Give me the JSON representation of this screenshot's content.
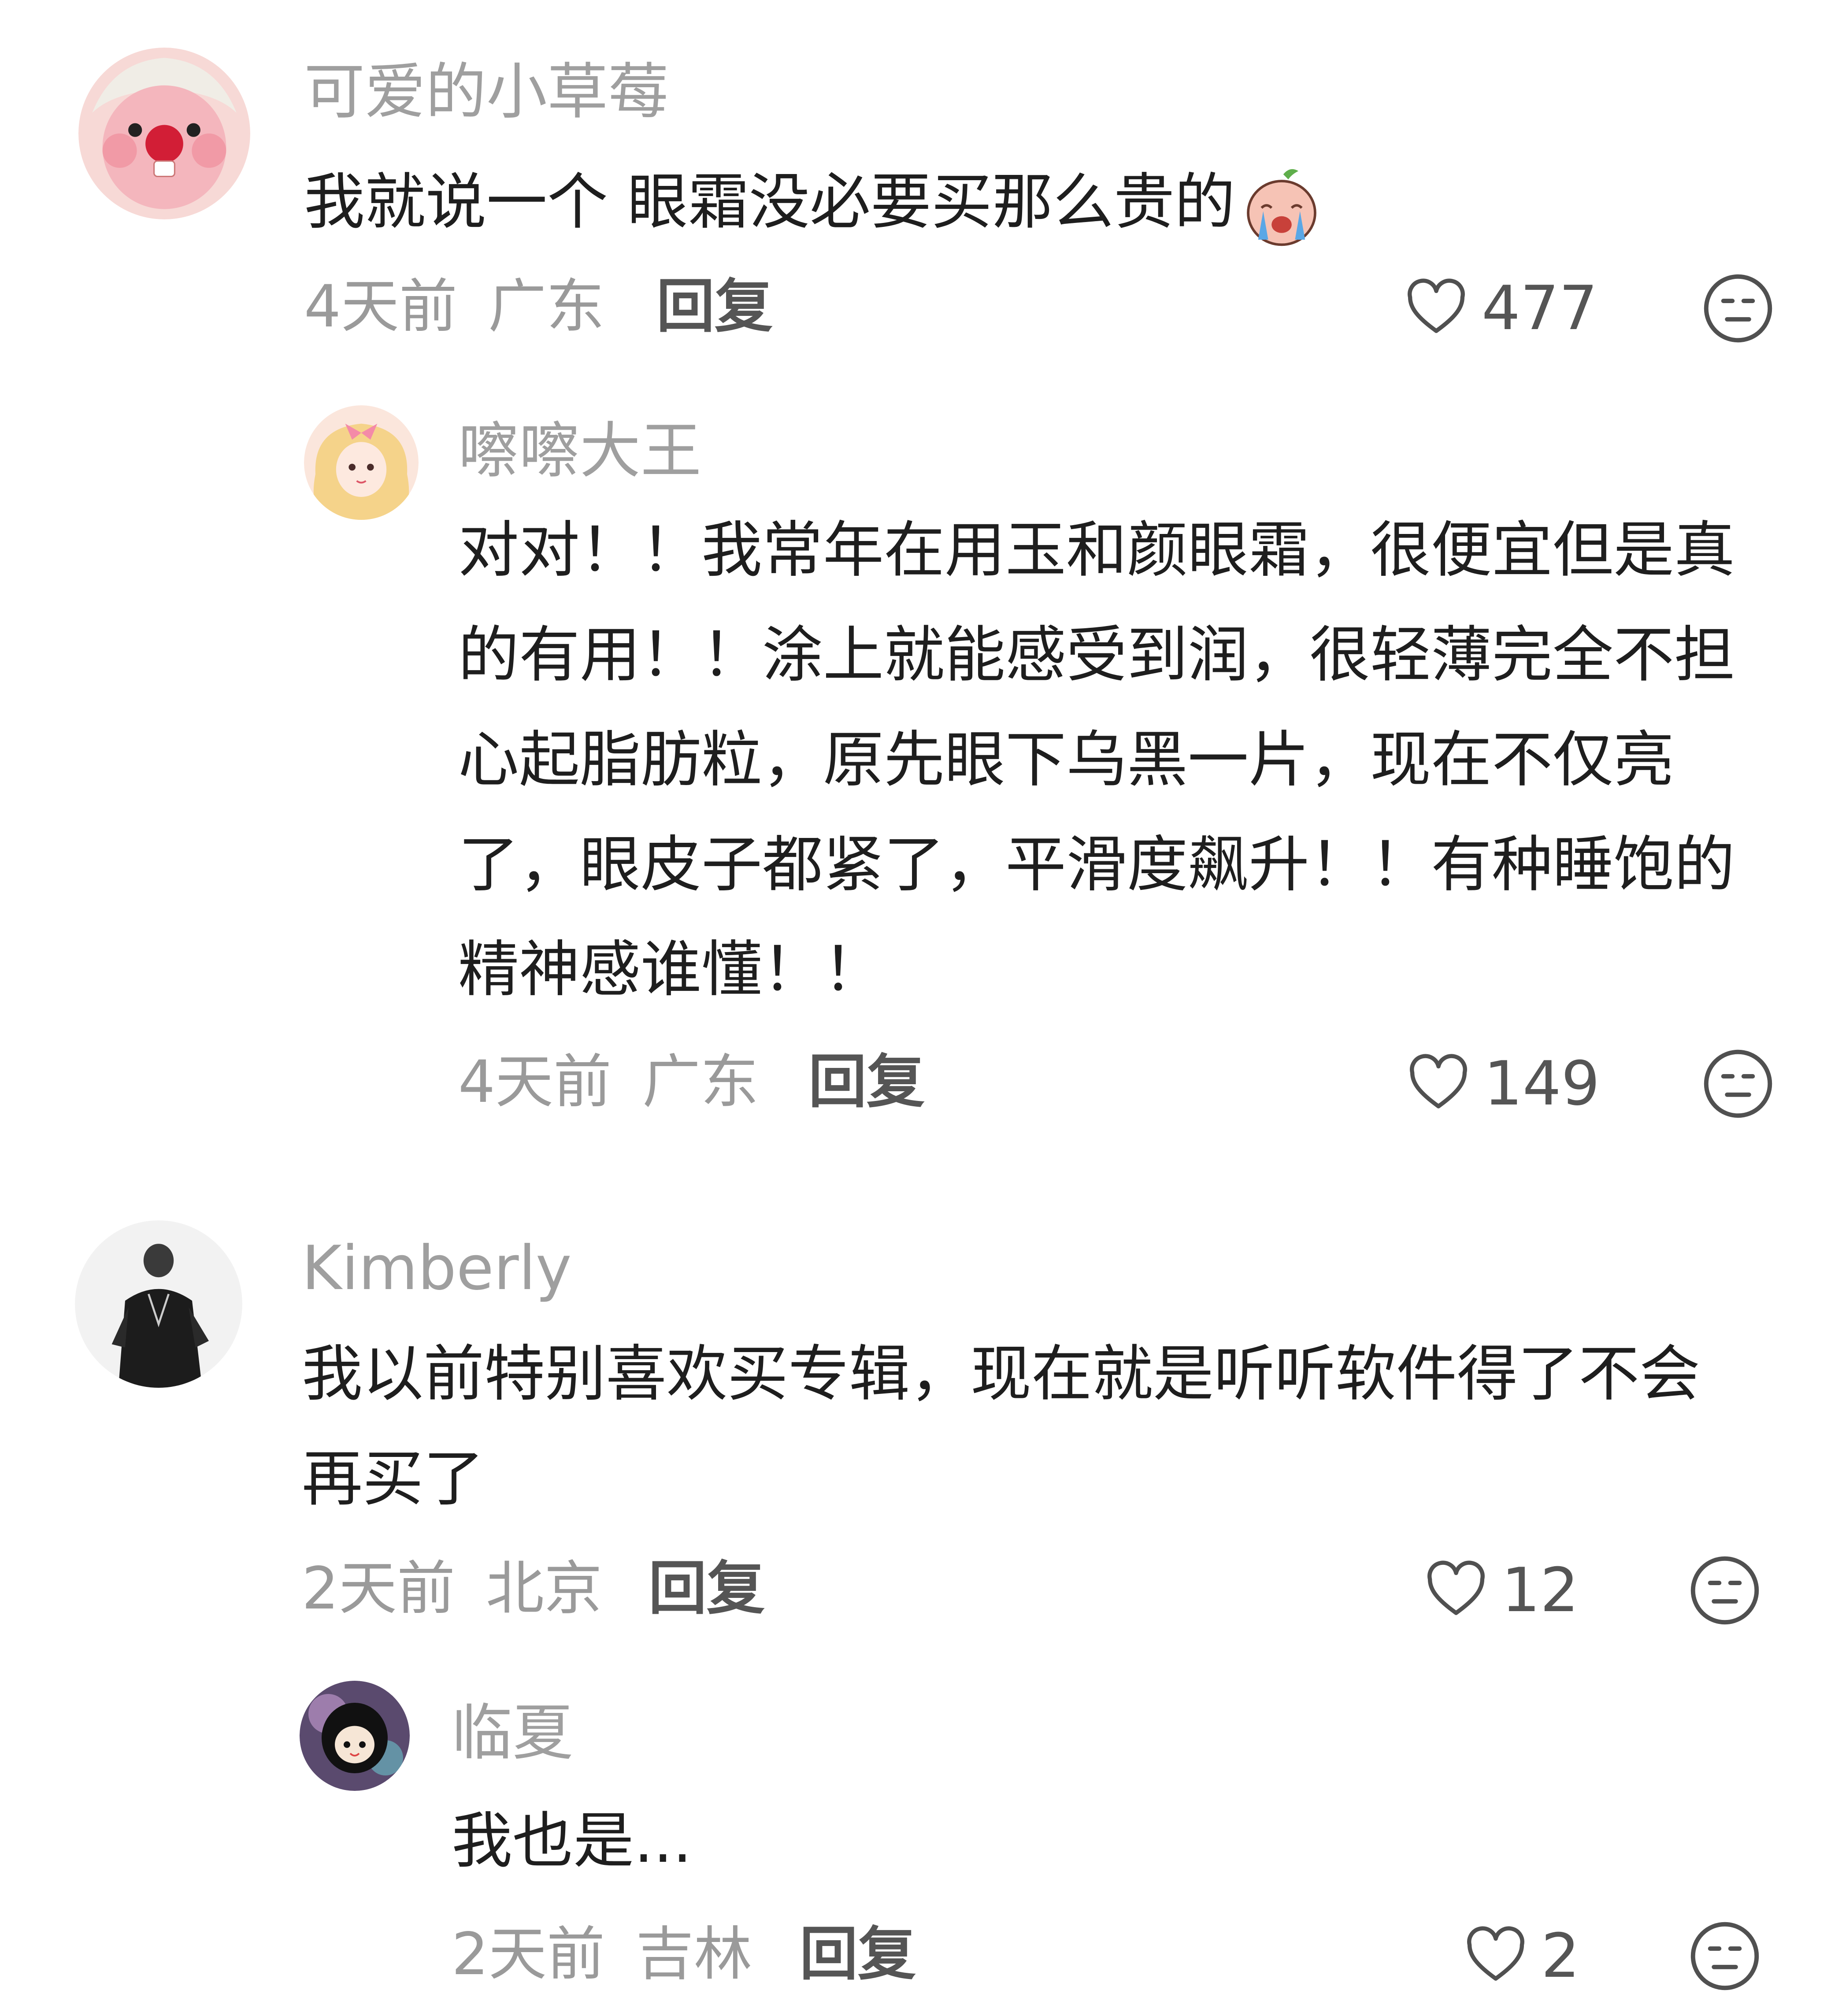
{
  "comments": [
    {
      "username": "可爱的小草莓",
      "text": "我就说一个 眼霜没必要买那么贵的",
      "emoji": "crying-peach-emoji",
      "time": "4天前",
      "location": "广东",
      "reply_label": "回复",
      "likes": "477",
      "replies": [
        {
          "username": "嚓嚓大王",
          "text": "对对！！我常年在用玉和颜眼霜，很便宜但是真的有用！！涂上就能感受到润，很轻薄完全不担心起脂肪粒，原先眼下乌黑一片，现在不仅亮了，眼皮子都紧了，平滑度飙升！！有种睡饱的精神感谁懂！！",
          "time": "4天前",
          "location": "广东",
          "reply_label": "回复",
          "likes": "149"
        }
      ]
    },
    {
      "username": "Kimberly",
      "text": "我以前特别喜欢买专辑，现在就是听听软件得了不会再买了",
      "time": "2天前",
      "location": "北京",
      "reply_label": "回复",
      "likes": "12",
      "replies": [
        {
          "username": "临夏",
          "text": "我也是...",
          "time": "2天前",
          "location": "吉林",
          "reply_label": "回复",
          "likes": "2"
        }
      ]
    }
  ],
  "icons": {
    "like": "heart-outline-icon",
    "dislike": "neutral-face-icon"
  },
  "colors": {
    "background": "#ffffff",
    "username": "#9f9f9f",
    "body_text": "#1e1e1e",
    "meta": "#9a9a9a",
    "reply": "#555555"
  }
}
